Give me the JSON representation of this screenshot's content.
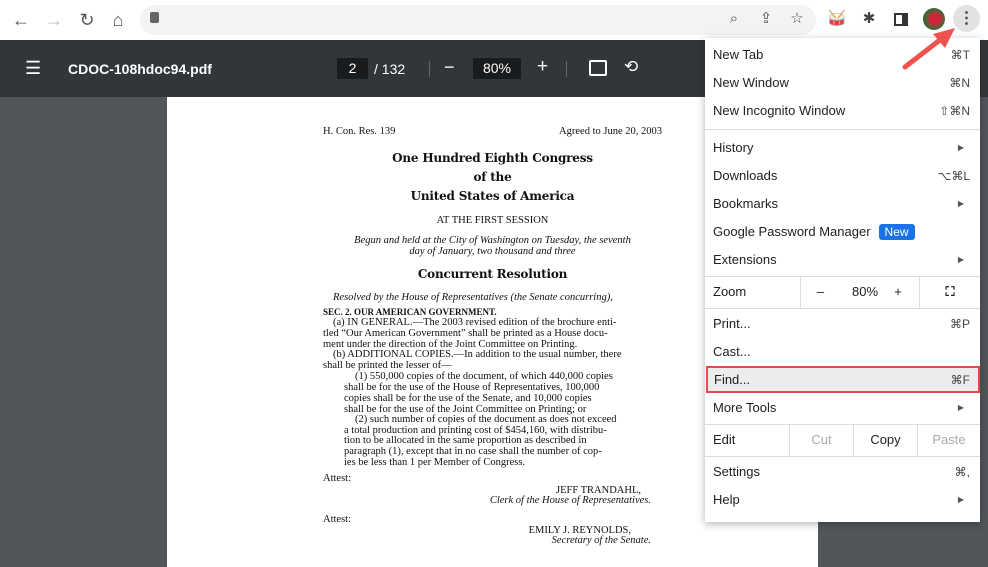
{
  "browser": {
    "nav_icons": [
      "back-icon",
      "forward-icon",
      "reload-icon",
      "home-icon",
      "lock-icon"
    ],
    "toolbar_icons": [
      "zoom-icon",
      "share-icon",
      "star-icon",
      "drum-extension-icon",
      "extensions-icon",
      "side-panel-icon",
      "profile-avatar",
      "more-menu-icon"
    ]
  },
  "pdf": {
    "filename": "CDOC-108hdoc94.pdf",
    "page": "2",
    "total": "/ 132",
    "zoom": "80%",
    "minus": "−",
    "plus": "+"
  },
  "doc": {
    "left_header": "H. Con. Res. 139",
    "right_header": "Agreed to June 20, 2003",
    "title1": "One Hundred Eighth Congress",
    "title2": "of the",
    "title3": "United States of America",
    "session": "AT THE FIRST SESSION",
    "begun1": "Begun and held at the City of Washington on Tuesday, the seventh",
    "begun2": "day of January, two thousand and three",
    "concurrent": "Concurrent Resolution",
    "resolved": "Resolved by the House of Representatives (the Senate concurring),",
    "sec": "SEC. 2. OUR AMERICAN GOVERNMENT.",
    "lines": [
      "(a) IN GENERAL.—The 2003 revised edition of the brochure enti-",
      "tled “Our American Government” shall be printed as a House docu-",
      "ment under the direction of the Joint Committee on Printing.",
      "(b) ADDITIONAL COPIES.—In addition to the usual number, there",
      "shall be printed the lesser of—",
      "(1) 550,000 copies of the document, of which 440,000 copies",
      "shall be for the use of the House of Representatives, 100,000",
      "copies shall be for the use of the Senate, and 10,000 copies",
      "shall be for the use of the Joint Committee on Printing; or",
      "(2) such number of copies of the document as does not exceed",
      "a total production and printing cost of $454,160, with distribu-",
      "tion to be allocated in the same proportion as described in",
      "paragraph (1), except that in no case shall the number of cop-",
      "ies be less than 1 per Member of Congress."
    ],
    "attest": "Attest:",
    "sig1": "JEFF TRANDAHL,",
    "title_sig1": "Clerk of the House of Representatives.",
    "sig2": "EMILY J. REYNOLDS,",
    "title_sig2": "Secretary of the Senate."
  },
  "menu": {
    "new_tab": "New Tab",
    "new_tab_sc": "⌘T",
    "new_window": "New Window",
    "new_window_sc": "⌘N",
    "incognito": "New Incognito Window",
    "incognito_sc": "⇧⌘N",
    "history": "History",
    "downloads": "Downloads",
    "downloads_sc": "⌥⌘L",
    "bookmarks": "Bookmarks",
    "password": "Google Password Manager",
    "new_badge": "New",
    "extensions": "Extensions",
    "zoom": "Zoom",
    "zoom_minus": "–",
    "zoom_value": "80%",
    "zoom_plus": "+",
    "print": "Print...",
    "print_sc": "⌘P",
    "cast": "Cast...",
    "find": "Find...",
    "find_sc": "⌘F",
    "more_tools": "More Tools",
    "edit": "Edit",
    "cut": "Cut",
    "copy": "Copy",
    "paste": "Paste",
    "settings": "Settings",
    "settings_sc": "⌘,",
    "help": "Help"
  },
  "accent": "#1a73e8",
  "highlight_color": "#e5484d"
}
